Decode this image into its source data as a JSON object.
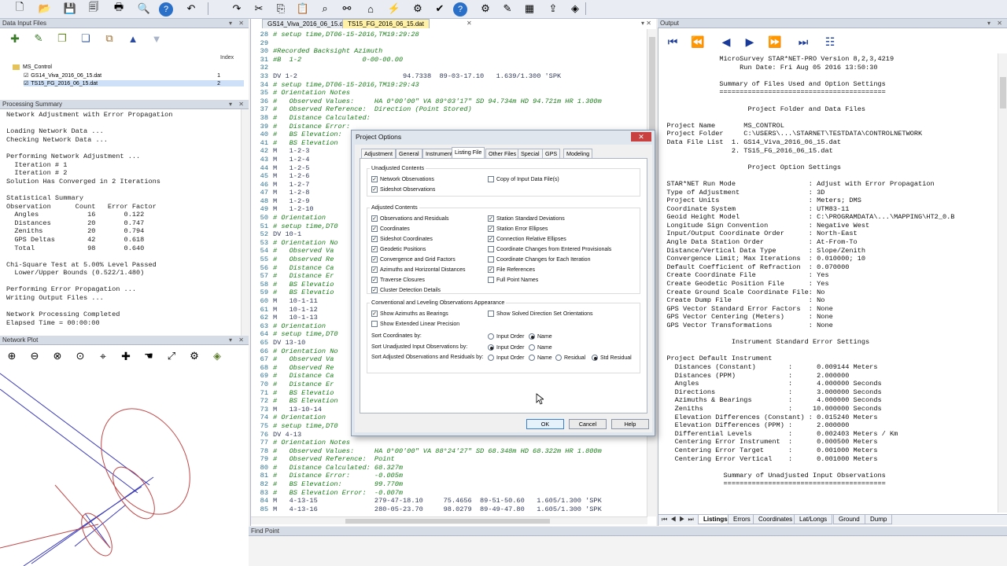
{
  "toolbar": {
    "icons": [
      "new-doc",
      "open-folder",
      "save",
      "save-all",
      "print",
      "zoom",
      "help",
      "undo",
      "redo",
      "cut",
      "copy",
      "paste",
      "find",
      "binoculars",
      "house",
      "adjust-run",
      "adjust-all",
      "check",
      "help-question",
      "settings",
      "tools",
      "calculator",
      "export",
      "layers"
    ]
  },
  "data_input_files": {
    "title": "Data Input Files",
    "index_header": "Index",
    "project": "MS_Control",
    "files": [
      {
        "name": "GS14_Viva_2016_06_15.dat",
        "index": "1"
      },
      {
        "name": "TS15_FG_2016_06_15.dat",
        "index": "2"
      }
    ]
  },
  "processing_summary": {
    "title": "Processing Summary",
    "lines": [
      "Network Adjustment with Error Propagation",
      "",
      "Loading Network Data ...",
      "Checking Network Data ...",
      "",
      "Performing Network Adjustment ...",
      "  Iteration # 1",
      "  Iteration # 2",
      "Solution Has Converged in 2 Iterations",
      "",
      "Statistical Summary",
      "Observation      Count   Error Factor",
      "  Angles            16       0.122",
      "  Distances         20       0.747",
      "  Zeniths           20       0.794",
      "  GPS Deltas        42       0.618",
      "  Total             98       0.640",
      "",
      "Chi-Square Test at 5.00% Level Passed",
      "  Lower/Upper Bounds (0.522/1.480)",
      "",
      "Performing Error Propagation ...",
      "Writing Output Files ...",
      "",
      "Network Processing Completed",
      "Elapsed Time = 00:00:00"
    ]
  },
  "network_plot": {
    "title": "Network Plot"
  },
  "editor": {
    "tabs": [
      "GS14_Viva_2016_06_15.dat",
      "TS15_FG_2016_06_15.dat"
    ],
    "lines": [
      {
        "n": "28",
        "t": "# setup time,DT06-15-2016,TM19:29:28",
        "c": "c-green"
      },
      {
        "n": "29",
        "t": "",
        "c": ""
      },
      {
        "n": "30",
        "t": "#Recorded Backsight Azimuth",
        "c": "c-green"
      },
      {
        "n": "31",
        "t": "#B  1-2               0-00-00.00",
        "c": "c-green"
      },
      {
        "n": "32",
        "t": "",
        "c": ""
      },
      {
        "n": "33",
        "t": "DV 1-2                          94.7338  89-03-17.10   1.639/1.300 'SPK",
        "c": "c-dark"
      },
      {
        "n": "34",
        "t": "# setup time,DT06-15-2016,TM19:29:43",
        "c": "c-green"
      },
      {
        "n": "35",
        "t": "# Orientation Notes",
        "c": "c-green"
      },
      {
        "n": "36",
        "t": "#   Observed Values:     HA 0°00'00\" VA 89°03'17\" SD 94.734m HD 94.721m HR 1.300m",
        "c": "c-green"
      },
      {
        "n": "37",
        "t": "#   Observed Reference:  Direction (Point Stored)",
        "c": "c-green"
      },
      {
        "n": "38",
        "t": "#   Distance Calculated:",
        "c": "c-green"
      },
      {
        "n": "39",
        "t": "#   Distance Error:",
        "c": "c-green"
      },
      {
        "n": "40",
        "t": "#   BS Elevation:",
        "c": "c-green"
      },
      {
        "n": "41",
        "t": "#   BS Elevation",
        "c": "c-green"
      },
      {
        "n": "42",
        "t": "M   1-2-3",
        "c": "c-dark"
      },
      {
        "n": "43",
        "t": "M   1-2-4",
        "c": "c-dark"
      },
      {
        "n": "44",
        "t": "M   1-2-5",
        "c": "c-dark"
      },
      {
        "n": "45",
        "t": "M   1-2-6",
        "c": "c-dark"
      },
      {
        "n": "46",
        "t": "M   1-2-7",
        "c": "c-dark"
      },
      {
        "n": "47",
        "t": "M   1-2-8",
        "c": "c-dark"
      },
      {
        "n": "48",
        "t": "M   1-2-9",
        "c": "c-dark"
      },
      {
        "n": "49",
        "t": "M   1-2-10",
        "c": "c-dark"
      },
      {
        "n": "50",
        "t": "# Orientation",
        "c": "c-green"
      },
      {
        "n": "51",
        "t": "# setup time,DT0",
        "c": "c-green"
      },
      {
        "n": "52",
        "t": "DV 10-1",
        "c": "c-dark"
      },
      {
        "n": "53",
        "t": "# Orientation No",
        "c": "c-green"
      },
      {
        "n": "54",
        "t": "#   Observed Va",
        "c": "c-green"
      },
      {
        "n": "55",
        "t": "#   Observed Re",
        "c": "c-green"
      },
      {
        "n": "56",
        "t": "#   Distance Ca",
        "c": "c-green"
      },
      {
        "n": "57",
        "t": "#   Distance Er",
        "c": "c-green"
      },
      {
        "n": "58",
        "t": "#   BS Elevatio",
        "c": "c-green"
      },
      {
        "n": "59",
        "t": "#   BS Elevatio",
        "c": "c-green"
      },
      {
        "n": "60",
        "t": "M   10-1-11",
        "c": "c-dark"
      },
      {
        "n": "61",
        "t": "M   10-1-12",
        "c": "c-dark"
      },
      {
        "n": "62",
        "t": "M   10-1-13",
        "c": "c-dark"
      },
      {
        "n": "63",
        "t": "# Orientation",
        "c": "c-green"
      },
      {
        "n": "64",
        "t": "# setup time,DT0",
        "c": "c-green"
      },
      {
        "n": "65",
        "t": "DV 13-10",
        "c": "c-dark"
      },
      {
        "n": "66",
        "t": "# Orientation No",
        "c": "c-green"
      },
      {
        "n": "67",
        "t": "#   Observed Va",
        "c": "c-green"
      },
      {
        "n": "68",
        "t": "#   Observed Re",
        "c": "c-green"
      },
      {
        "n": "69",
        "t": "#   Distance Ca",
        "c": "c-green"
      },
      {
        "n": "70",
        "t": "#   Distance Er",
        "c": "c-green"
      },
      {
        "n": "71",
        "t": "#   BS Elevatio",
        "c": "c-green"
      },
      {
        "n": "72",
        "t": "#   BS Elevation",
        "c": "c-green"
      },
      {
        "n": "73",
        "t": "M   13-10-14",
        "c": "c-dark"
      },
      {
        "n": "74",
        "t": "# Orientation",
        "c": "c-green"
      },
      {
        "n": "75",
        "t": "# setup time,DT0",
        "c": "c-green"
      },
      {
        "n": "76",
        "t": "DV 4-13",
        "c": "c-dark"
      },
      {
        "n": "77",
        "t": "# Orientation Notes",
        "c": "c-green"
      },
      {
        "n": "78",
        "t": "#   Observed Values:     HA 0°00'00\" VA 88°24'27\" SD 68.348m HD 68.322m HR 1.800m",
        "c": "c-green"
      },
      {
        "n": "79",
        "t": "#   Observed Reference:  Point",
        "c": "c-green"
      },
      {
        "n": "80",
        "t": "#   Distance Calculated: 68.327m",
        "c": "c-green"
      },
      {
        "n": "81",
        "t": "#   Distance Error:      -0.005m",
        "c": "c-green"
      },
      {
        "n": "82",
        "t": "#   BS Elevation:        99.770m",
        "c": "c-green"
      },
      {
        "n": "83",
        "t": "#   BS Elevation Error:  -0.007m",
        "c": "c-green"
      },
      {
        "n": "84",
        "t": "M   4-13-15              279-47-18.10     75.4656  89-51-50.60   1.605/1.300 'SPK",
        "c": "c-dark"
      },
      {
        "n": "85",
        "t": "M   4-13-16              280-05-23.70     98.0279  89-49-47.80   1.605/1.300 'SPK",
        "c": "c-dark"
      }
    ]
  },
  "output": {
    "title": "Output",
    "lines": [
      "               MicroSurvey STAR*NET-PRO Version 8,2,3,4219",
      "                    Run Date: Fri Aug 05 2016 13:50:30",
      "",
      "               Summary of Files Used and Option Settings",
      "               =========================================",
      "",
      "                      Project Folder and Data Files",
      "",
      "  Project Name       MS_CONTROL",
      "  Project Folder     C:\\USERS\\...\\STARNET\\TESTDATA\\CONTROLNETWORK",
      "  Data File List  1. GS14_Viva_2016_06_15.dat",
      "                  2. TS15_FG_2016_06_15.dat",
      "",
      "                      Project Option Settings",
      "",
      "  STAR*NET Run Mode                  : Adjust with Error Propagation",
      "  Type of Adjustment                 : 3D",
      "  Project Units                      : Meters; DMS",
      "  Coordinate System                  : UTM83-11",
      "  Geoid Height Model                 : C:\\PROGRAMDATA\\...\\MAPPING\\HT2_0.B",
      "  Longitude Sign Convention          : Negative West",
      "  Input/Output Coordinate Order      : North-East",
      "  Angle Data Station Order           : At-From-To",
      "  Distance/Vertical Data Type        : Slope/Zenith",
      "  Convergence Limit; Max Iterations  : 0.010000; 10",
      "  Default Coefficient of Refraction  : 0.070000",
      "  Create Coordinate File             : Yes",
      "  Create Geodetic Position File      : Yes",
      "  Create Ground Scale Coordinate File: No",
      "  Create Dump File                   : No",
      "  GPS Vector Standard Error Factors  : None",
      "  GPS Vector Centering (Meters)      : None",
      "  GPS Vector Transformations         : None",
      "",
      "                  Instrument Standard Error Settings",
      "",
      "  Project Default Instrument",
      "    Distances (Constant)        :      0.009144 Meters",
      "    Distances (PPM)             :      2.000000",
      "    Angles                      :      4.000000 Seconds",
      "    Directions                  :      3.000000 Seconds",
      "    Azimuths & Bearings         :      4.000000 Seconds",
      "    Zeniths                     :     10.000000 Seconds",
      "    Elevation Differences (Constant) : 0.015240 Meters",
      "    Elevation Differences (PPM) :      2.000000",
      "    Differential Levels         :      0.002403 Meters / Km",
      "    Centering Error Instrument  :      0.000500 Meters",
      "    Centering Error Target      :      0.001000 Meters",
      "    Centering Error Vertical    :      0.001000 Meters",
      "",
      "                Summary of Unadjusted Input Observations",
      "                ========================================"
    ],
    "bottom_tabs": [
      "Listings",
      "Errors",
      "Coordinates",
      "Lat/Longs",
      "Ground",
      "Dump"
    ]
  },
  "find_point": {
    "title": "Find Point"
  },
  "dialog": {
    "title": "Project Options",
    "close": "✕",
    "tabs": [
      "Adjustment",
      "General",
      "Instrument",
      "Listing File",
      "Other Files",
      "Special",
      "GPS",
      "Modeling"
    ],
    "active_tab": "Listing File",
    "unadjusted": {
      "label": "Unadjusted Contents",
      "items": [
        {
          "label": "Network Observations",
          "checked": true
        },
        {
          "label": "Sideshot Observations",
          "checked": true
        },
        {
          "label": "Copy of Input Data File(s)",
          "checked": false
        }
      ]
    },
    "adjusted": {
      "label": "Adjusted Contents",
      "left": [
        {
          "label": "Observations and Residuals",
          "checked": true
        },
        {
          "label": "Coordinates",
          "checked": true
        },
        {
          "label": "Sideshot Coordinates",
          "checked": true
        },
        {
          "label": "Geodetic Positions",
          "checked": true
        },
        {
          "label": "Convergence and Grid Factors",
          "checked": true
        },
        {
          "label": "Azimuths and Horizontal Distances",
          "checked": true
        },
        {
          "label": "Traverse Closures",
          "checked": true
        },
        {
          "label": "Cluster Detection Details",
          "checked": true
        }
      ],
      "right": [
        {
          "label": "Station Standard Deviations",
          "checked": true
        },
        {
          "label": "Station Error Ellipses",
          "checked": true
        },
        {
          "label": "Connection Relative Ellipses",
          "checked": true
        },
        {
          "label": "Coordinate Changes from Entered Provisionals",
          "checked": false
        },
        {
          "label": "Coordinate Changes for Each Iteration",
          "checked": false
        },
        {
          "label": "File References",
          "checked": true
        },
        {
          "label": "Full Point Names",
          "checked": false
        }
      ]
    },
    "appearance": {
      "label": "Conventional and Leveling Observations Appearance",
      "show_azimuths": {
        "label": "Show Azimuths as Bearings",
        "checked": true
      },
      "show_solved": {
        "label": "Show Solved Direction Set Orientations",
        "checked": false
      },
      "show_extended": {
        "label": "Show Extended Linear Precision",
        "checked": false
      },
      "sort_coords": {
        "label": "Sort Coordinates by:",
        "options": [
          "Input Order",
          "Name"
        ],
        "selected": 1
      },
      "sort_unadj": {
        "label": "Sort Unadjusted Input Observations by:",
        "options": [
          "Input Order",
          "Name"
        ],
        "selected": 0
      },
      "sort_adj": {
        "label": "Sort Adjusted Observations and Residuals by:",
        "options": [
          "Input Order",
          "Name",
          "Residual",
          "Std Residual"
        ],
        "selected": 3
      }
    },
    "buttons": {
      "ok": "OK",
      "cancel": "Cancel",
      "help": "Help"
    }
  }
}
